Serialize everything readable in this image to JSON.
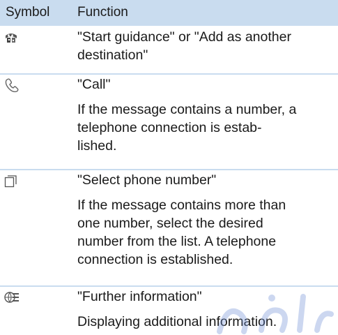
{
  "table": {
    "header": {
      "symbol": "Symbol",
      "function": "Function"
    },
    "rows": [
      {
        "icon": "checkered-flag-icon",
        "lines": [
          "\"Start guidance\" or \"Add as another",
          "destination\""
        ],
        "description": []
      },
      {
        "icon": "phone-handset-icon",
        "lines": [
          "\"Call\""
        ],
        "description": [
          "If the message contains a number, a",
          "telephone connection is estab-",
          "lished."
        ]
      },
      {
        "icon": "select-list-icon",
        "lines": [
          "\"Select phone number\""
        ],
        "description": [
          "If the message contains more than",
          "one number, select the desired",
          "number from the list. A telephone",
          "connection is established."
        ]
      },
      {
        "icon": "info-globe-icon",
        "lines": [
          "\"Further information\""
        ],
        "description": [
          "Displaying additional information."
        ]
      }
    ]
  },
  "colors": {
    "header_bg": "#c9dcef",
    "separator": "#c9dcef",
    "text": "#1a1a1a"
  }
}
